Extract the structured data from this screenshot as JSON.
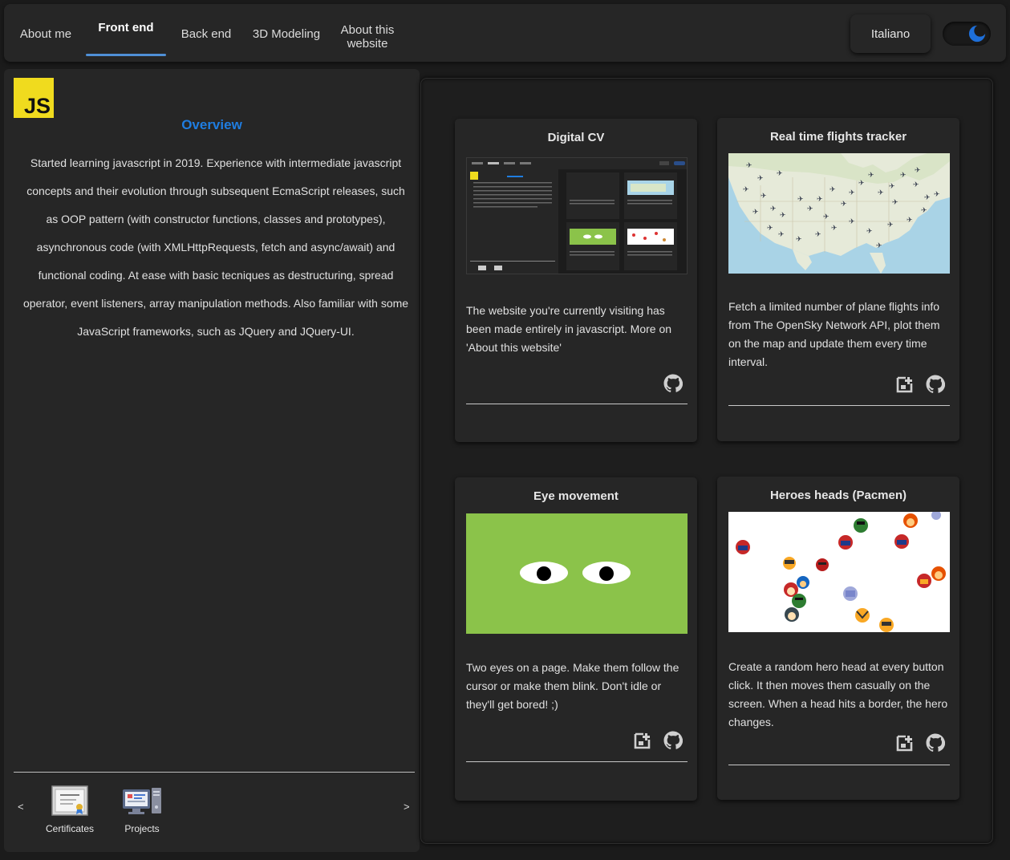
{
  "nav": {
    "tabs": [
      {
        "label": "About me"
      },
      {
        "label": "Front end"
      },
      {
        "label": "Back end"
      },
      {
        "label": "3D Modeling"
      },
      {
        "label": "About this website"
      }
    ],
    "active_tab": "Front end",
    "language_button": "Italiano",
    "theme_toggle": "dark"
  },
  "left": {
    "logo_text": "JS",
    "title": "Overview",
    "text": "Started learning javascript in 2019. Experience with intermediate javascript concepts and their evolution through subsequent EcmaScript releases, such as OOP pattern (with constructor functions, classes and prototypes), asynchronous code (with XMLHttpRequests, fetch and async/await) and functional coding. At ease with basic tecniques as destructuring, spread operator, event listeners, array manipulation methods. Also familiar with some JavaScript frameworks, such as JQuery and JQuery-UI.",
    "prev_arrow": "<",
    "next_arrow": ">",
    "bottom_items": [
      {
        "label": "Certificates",
        "icon": "certificate-icon"
      },
      {
        "label": "Projects",
        "icon": "projects-icon"
      }
    ]
  },
  "cards": [
    {
      "title": "Digital CV",
      "description": "The website you're currently visiting has been made entirely in javascript. More on 'About this website'",
      "icons": [
        "github-icon"
      ]
    },
    {
      "title": "Real time flights tracker",
      "description": "Fetch a limited number of plane flights info from The OpenSky Network API, plot them on the map and update them every time interval.",
      "icons": [
        "open-demo-icon",
        "github-icon"
      ]
    },
    {
      "title": "Eye movement",
      "description": "Two eyes on a page. Make them follow the cursor or make them blink. Don't idle or they'll get bored! ;)",
      "icons": [
        "open-demo-icon",
        "github-icon"
      ]
    },
    {
      "title": "Heroes heads (Pacmen)",
      "description": "Create a random hero head at every button click. It then moves them casually on the screen. When a head hits a border, the hero changes.",
      "icons": [
        "open-demo-icon",
        "github-icon"
      ]
    }
  ],
  "colors": {
    "accent": "#1f7de0",
    "tab_underline": "#4f8fd6",
    "js_yellow": "#f0db1e",
    "eye_background": "#8bc34a"
  }
}
